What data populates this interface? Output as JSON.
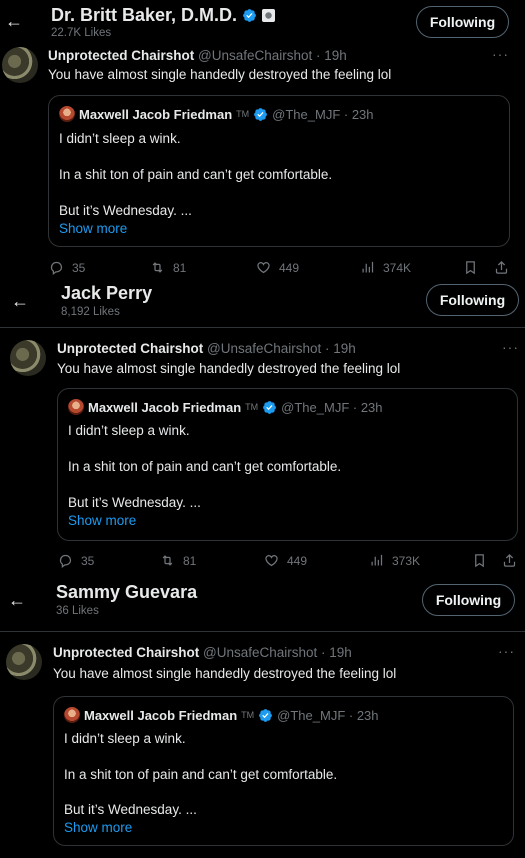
{
  "panels": [
    {
      "header": {
        "name": "Dr. Britt Baker, D.M.D.",
        "likes": "22.7K Likes",
        "follow_label": "Following"
      },
      "tweet": {
        "author_name": "Unprotected Chairshot",
        "author_meta": "@UnsafeChairshot · 19h",
        "text": "You have almost single handedly destroyed the feeling lol",
        "more": "···",
        "quote": {
          "author_name": "Maxwell Jacob Friedman",
          "tm": "TM",
          "meta": "@The_MJF · 23h",
          "line1": "I didn’t sleep a wink.",
          "line2": "In a shit ton of pain and can’t get comfortable.",
          "line3": "But it’s Wednesday. ...",
          "show_more": "Show more"
        },
        "actions": {
          "replies": "35",
          "reposts": "81",
          "likes": "449",
          "views": "374K"
        }
      }
    },
    {
      "header": {
        "name": "Jack Perry",
        "likes": "8,192 Likes",
        "follow_label": "Following"
      },
      "tweet": {
        "author_name": "Unprotected Chairshot",
        "author_meta": "@UnsafeChairshot · 19h",
        "text": "You have almost single handedly destroyed the feeling lol",
        "more": "···",
        "quote": {
          "author_name": "Maxwell Jacob Friedman",
          "tm": "TM",
          "meta": "@The_MJF · 23h",
          "line1": "I didn’t sleep a wink.",
          "line2": "In a shit ton of pain and can’t get comfortable.",
          "line3": "But it’s Wednesday. ...",
          "show_more": "Show more"
        },
        "actions": {
          "replies": "35",
          "reposts": "81",
          "likes": "449",
          "views": "373K"
        }
      }
    },
    {
      "header": {
        "name": "Sammy Guevara",
        "likes": "36 Likes",
        "follow_label": "Following"
      },
      "tweet": {
        "author_name": "Unprotected Chairshot",
        "author_meta": "@UnsafeChairshot · 19h",
        "text": "You have almost single handedly destroyed the feeling lol",
        "more": "···",
        "quote": {
          "author_name": "Maxwell Jacob Friedman",
          "tm": "TM",
          "meta": "@The_MJF · 23h",
          "line1": "I didn’t sleep a wink.",
          "line2": "In a shit ton of pain and can’t get comfortable.",
          "line3": "But it’s Wednesday. ...",
          "show_more": "Show more"
        }
      }
    }
  ],
  "colors": {
    "background": "#000000",
    "text": "#e7e9ea",
    "muted": "#71767b",
    "link": "#1d9bf0",
    "border": "#2f3336"
  }
}
